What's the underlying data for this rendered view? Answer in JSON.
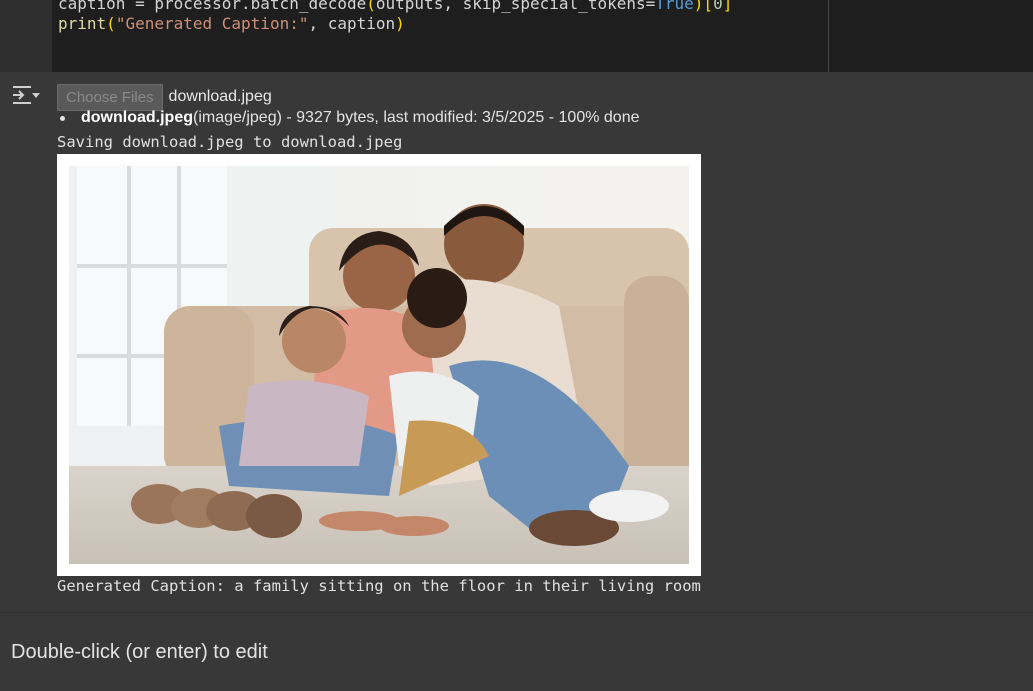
{
  "code_cell": {
    "line1": {
      "a": "caption = processor.batch_decode",
      "b": "(",
      "c": "outputs, skip_special_tokens=",
      "d": "True",
      "e": ")",
      "f": "[",
      "g": "0",
      "h": "]"
    },
    "line2": {
      "fn": "print",
      "open": "(",
      "str": "\"Generated Caption:\"",
      "rest": ", caption",
      "close": ")"
    }
  },
  "output": {
    "choose_files_label": "Choose Files",
    "selected_file": "download.jpeg",
    "file_entry": {
      "name": "download.jpeg",
      "details": "(image/jpeg) - 9327 bytes, last modified: 3/5/2025 - 100% done"
    },
    "saving_line": "Saving download.jpeg to download.jpeg",
    "caption_line": "Generated Caption: a family sitting on the floor in their living room",
    "toggle_icon": "output-collapse-icon"
  },
  "text_cell": {
    "placeholder": "Double-click (or enter) to edit"
  }
}
